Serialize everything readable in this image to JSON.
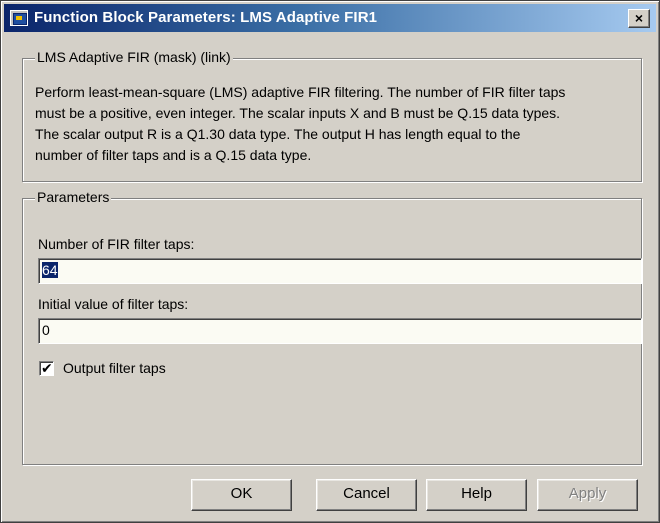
{
  "window": {
    "title": "Function Block Parameters: LMS Adaptive FIR1",
    "close_label": "×"
  },
  "description_group": {
    "legend": "LMS Adaptive FIR (mask) (link)",
    "lines": [
      "Perform least-mean-square (LMS) adaptive FIR filtering. The number of FIR filter taps",
      "must be a positive, even integer. The scalar inputs X and B must be Q.15 data types.",
      "The scalar output R is a Q1.30 data type. The output H has length equal to the",
      "number of filter taps and is a Q.15 data type."
    ]
  },
  "parameters_group": {
    "legend": "Parameters",
    "num_taps": {
      "label": "Number of FIR filter taps:",
      "value": "64"
    },
    "initial_value": {
      "label": "Initial value of filter taps:",
      "value": "0"
    },
    "output_taps": {
      "label": "Output filter taps",
      "checked": true,
      "mark": "✔"
    }
  },
  "buttons": {
    "ok": "OK",
    "cancel": "Cancel",
    "help": "Help",
    "apply": "Apply"
  }
}
